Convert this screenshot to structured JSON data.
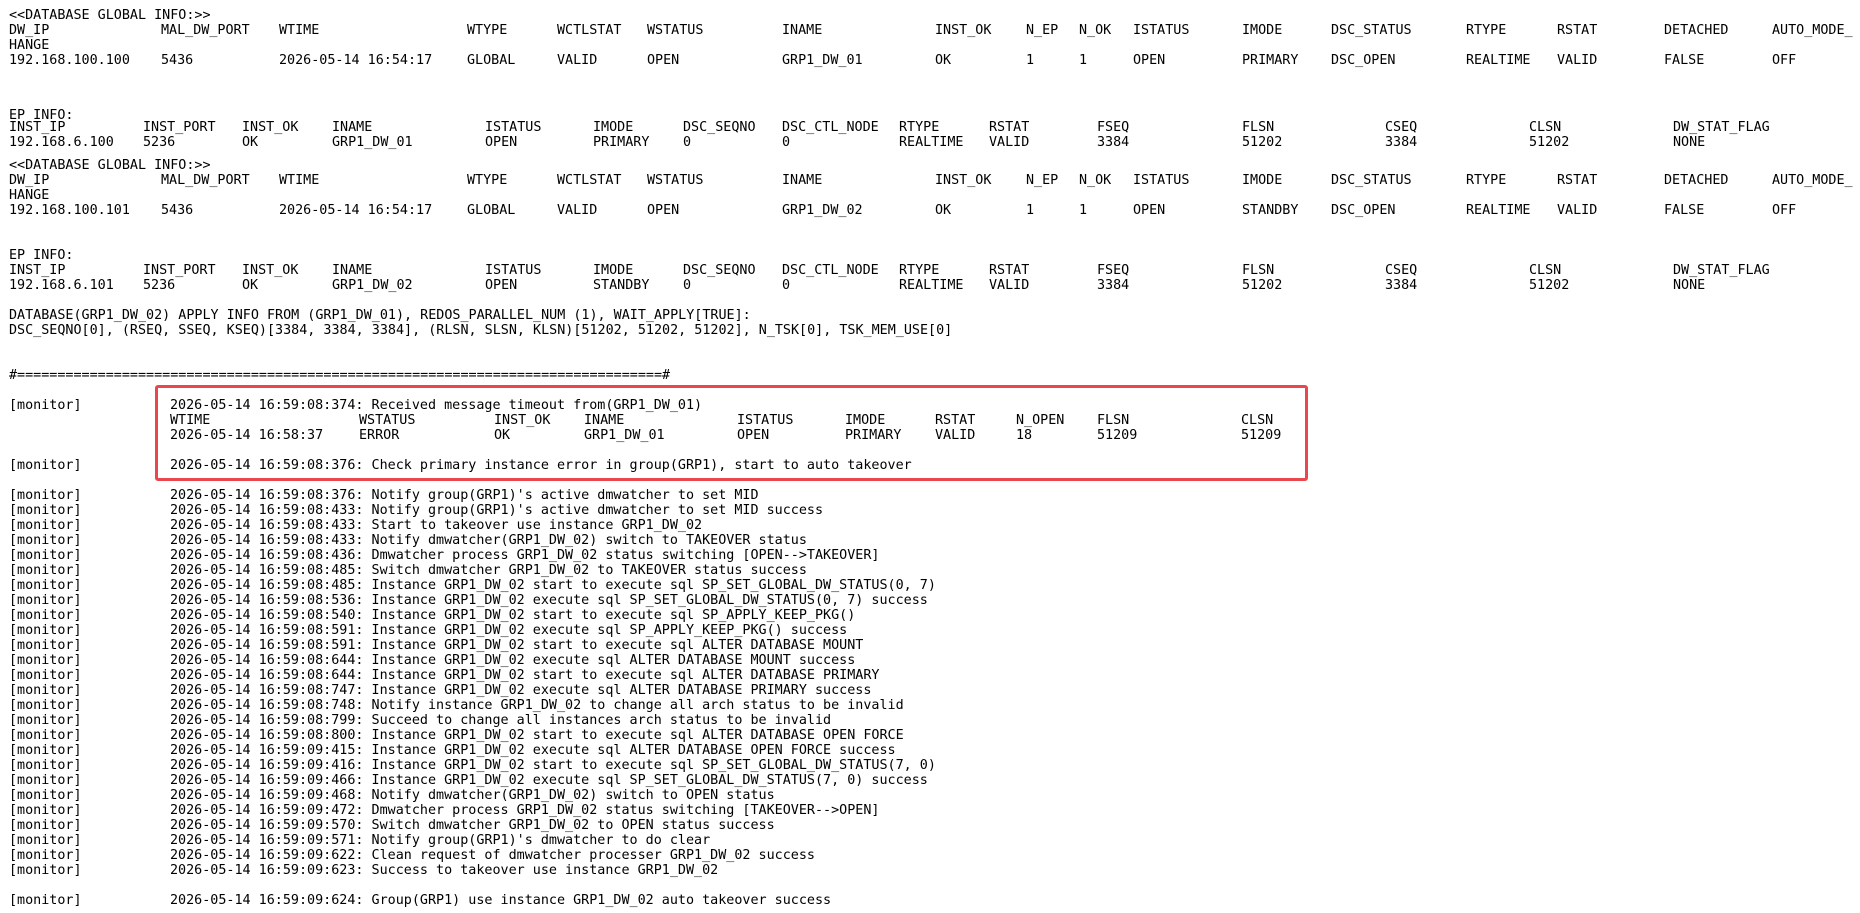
{
  "colors": {
    "background": "#ffffff",
    "text": "#000000",
    "highlight_border": "#e8474e"
  },
  "block1": {
    "title": "<<DATABASE GLOBAL INFO:>>",
    "headers": [
      "DW_IP",
      "MAL_DW_PORT",
      "WTIME",
      "WTYPE",
      "WCTLSTAT",
      "WSTATUS",
      "INAME",
      "INST_OK",
      "N_EP",
      "N_OK",
      "ISTATUS",
      "IMODE",
      "DSC_STATUS",
      "RTYPE",
      "RSTAT",
      "DETACHED",
      "AUTO_MODE_"
    ],
    "header_wrap": "HANGE",
    "values": [
      "192.168.100.100",
      "5436",
      "2026-05-14 16:54:17",
      "GLOBAL",
      "VALID",
      "OPEN",
      "GRP1_DW_01",
      "OK",
      "1",
      "1",
      "OPEN",
      "PRIMARY",
      "DSC_OPEN",
      "REALTIME",
      "VALID",
      "FALSE",
      "OFF"
    ]
  },
  "ep1": {
    "title": "EP INFO:",
    "headers": [
      "INST_IP",
      "INST_PORT",
      "INST_OK",
      "INAME",
      "ISTATUS",
      "IMODE",
      "DSC_SEQNO",
      "DSC_CTL_NODE",
      "RTYPE",
      "RSTAT",
      "FSEQ",
      "FLSN",
      "CSEQ",
      "CLSN",
      "DW_STAT_FLAG"
    ],
    "values": [
      "192.168.6.100",
      "5236",
      "OK",
      "GRP1_DW_01",
      "OPEN",
      "PRIMARY",
      "0",
      "0",
      "REALTIME",
      "VALID",
      "3384",
      "51202",
      "3384",
      "51202",
      "NONE"
    ]
  },
  "block2": {
    "title": "<<DATABASE GLOBAL INFO:>>",
    "headers": [
      "DW_IP",
      "MAL_DW_PORT",
      "WTIME",
      "WTYPE",
      "WCTLSTAT",
      "WSTATUS",
      "INAME",
      "INST_OK",
      "N_EP",
      "N_OK",
      "ISTATUS",
      "IMODE",
      "DSC_STATUS",
      "RTYPE",
      "RSTAT",
      "DETACHED",
      "AUTO_MODE_"
    ],
    "header_wrap": "HANGE",
    "values": [
      "192.168.100.101",
      "5436",
      "2026-05-14 16:54:17",
      "GLOBAL",
      "VALID",
      "OPEN",
      "GRP1_DW_02",
      "OK",
      "1",
      "1",
      "OPEN",
      "STANDBY",
      "DSC_OPEN",
      "REALTIME",
      "VALID",
      "FALSE",
      "OFF"
    ]
  },
  "ep2": {
    "title": "EP INFO:",
    "headers": [
      "INST_IP",
      "INST_PORT",
      "INST_OK",
      "INAME",
      "ISTATUS",
      "IMODE",
      "DSC_SEQNO",
      "DSC_CTL_NODE",
      "RTYPE",
      "RSTAT",
      "FSEQ",
      "FLSN",
      "CSEQ",
      "CLSN",
      "DW_STAT_FLAG"
    ],
    "values": [
      "192.168.6.101",
      "5236",
      "OK",
      "GRP1_DW_02",
      "OPEN",
      "STANDBY",
      "0",
      "0",
      "REALTIME",
      "VALID",
      "3384",
      "51202",
      "3384",
      "51202",
      "NONE"
    ]
  },
  "apply_info": {
    "line1": "DATABASE(GRP1_DW_02) APPLY INFO FROM (GRP1_DW_01), REDOS_PARALLEL_NUM (1), WAIT_APPLY[TRUE]:",
    "line2": "DSC_SEQNO[0], (RSEQ, SSEQ, KSEQ)[3384, 3384, 3384], (RLSN, SLSN, KLSN)[51202, 51202, 51202], N_TSK[0], TSK_MEM_USE[0]"
  },
  "separator": "#================================================================================#",
  "monitor_tag": "[monitor]",
  "timeout_block": {
    "message": "2026-05-14 16:59:08:374: Received message timeout from(GRP1_DW_01)",
    "headers": [
      "WTIME",
      "WSTATUS",
      "INST_OK",
      "INAME",
      "ISTATUS",
      "IMODE",
      "RSTAT",
      "N_OPEN",
      "FLSN",
      "CLSN"
    ],
    "values": [
      "2026-05-14 16:58:37",
      "ERROR",
      "OK",
      "GRP1_DW_01",
      "OPEN",
      "PRIMARY",
      "VALID",
      "18",
      "51209",
      "51209"
    ],
    "check_message": "2026-05-14 16:59:08:376: Check primary instance error in group(GRP1), start to auto takeover"
  },
  "log": [
    "2026-05-14 16:59:08:376: Notify group(GRP1)'s active dmwatcher to set MID",
    "2026-05-14 16:59:08:433: Notify group(GRP1)'s active dmwatcher to set MID success",
    "2026-05-14 16:59:08:433: Start to takeover use instance GRP1_DW_02",
    "2026-05-14 16:59:08:433: Notify dmwatcher(GRP1_DW_02) switch to TAKEOVER status",
    "2026-05-14 16:59:08:436: Dmwatcher process GRP1_DW_02 status switching [OPEN-->TAKEOVER]",
    "2026-05-14 16:59:08:485: Switch dmwatcher GRP1_DW_02 to TAKEOVER status success",
    "2026-05-14 16:59:08:485: Instance GRP1_DW_02 start to execute sql SP_SET_GLOBAL_DW_STATUS(0, 7)",
    "2026-05-14 16:59:08:536: Instance GRP1_DW_02 execute sql SP_SET_GLOBAL_DW_STATUS(0, 7) success",
    "2026-05-14 16:59:08:540: Instance GRP1_DW_02 start to execute sql SP_APPLY_KEEP_PKG()",
    "2026-05-14 16:59:08:591: Instance GRP1_DW_02 execute sql SP_APPLY_KEEP_PKG() success",
    "2026-05-14 16:59:08:591: Instance GRP1_DW_02 start to execute sql ALTER DATABASE MOUNT",
    "2026-05-14 16:59:08:644: Instance GRP1_DW_02 execute sql ALTER DATABASE MOUNT success",
    "2026-05-14 16:59:08:644: Instance GRP1_DW_02 start to execute sql ALTER DATABASE PRIMARY",
    "2026-05-14 16:59:08:747: Instance GRP1_DW_02 execute sql ALTER DATABASE PRIMARY success",
    "2026-05-14 16:59:08:748: Notify instance GRP1_DW_02 to change all arch status to be invalid",
    "2026-05-14 16:59:08:799: Succeed to change all instances arch status to be invalid",
    "2026-05-14 16:59:08:800: Instance GRP1_DW_02 start to execute sql ALTER DATABASE OPEN FORCE",
    "2026-05-14 16:59:09:415: Instance GRP1_DW_02 execute sql ALTER DATABASE OPEN FORCE success",
    "2026-05-14 16:59:09:416: Instance GRP1_DW_02 start to execute sql SP_SET_GLOBAL_DW_STATUS(7, 0)",
    "2026-05-14 16:59:09:466: Instance GRP1_DW_02 execute sql SP_SET_GLOBAL_DW_STATUS(7, 0) success",
    "2026-05-14 16:59:09:468: Notify dmwatcher(GRP1_DW_02) switch to OPEN status",
    "2026-05-14 16:59:09:472: Dmwatcher process GRP1_DW_02 status switching [TAKEOVER-->OPEN]",
    "2026-05-14 16:59:09:570: Switch dmwatcher GRP1_DW_02 to OPEN status success",
    "2026-05-14 16:59:09:571: Notify group(GRP1)'s dmwatcher to do clear",
    "2026-05-14 16:59:09:622: Clean request of dmwatcher processer GRP1_DW_02 success",
    "2026-05-14 16:59:09:623: Success to takeover use instance GRP1_DW_02"
  ],
  "final_message": "2026-05-14 16:59:09:624: Group(GRP1) use instance GRP1_DW_02 auto takeover success"
}
